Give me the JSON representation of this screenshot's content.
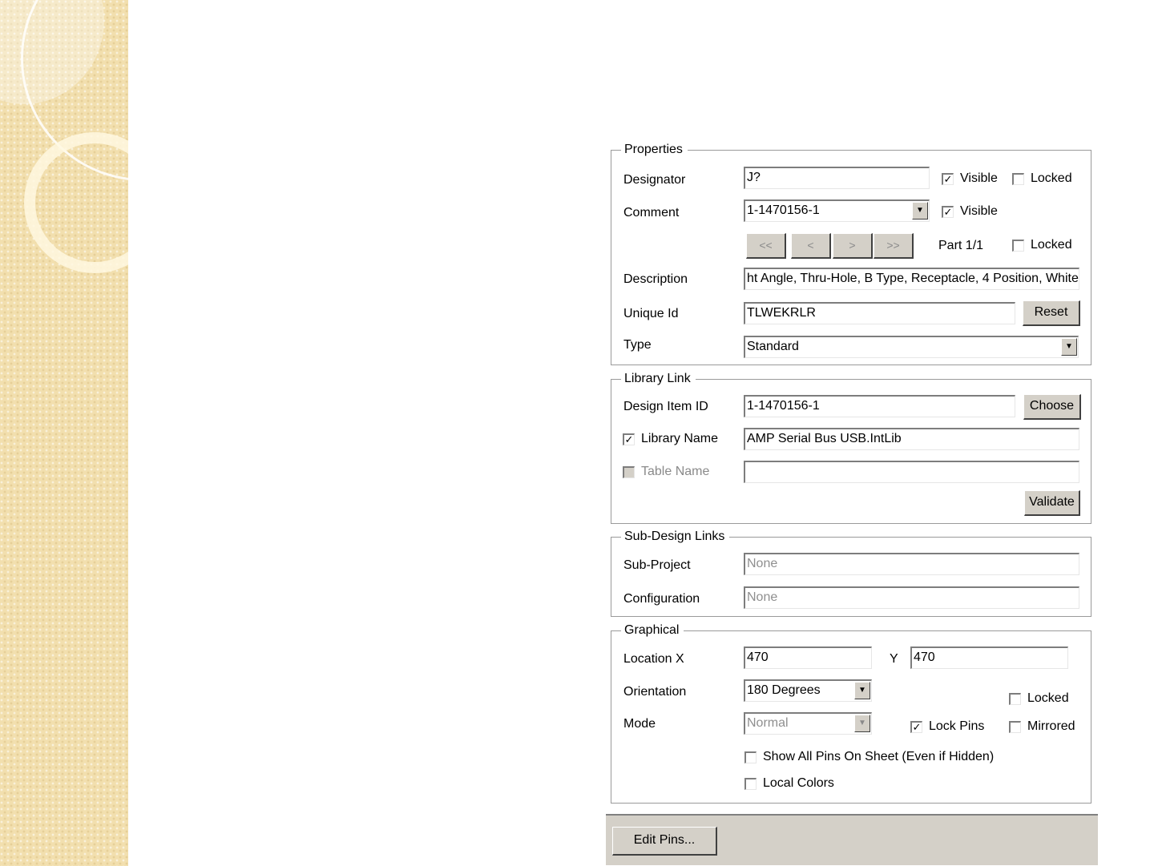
{
  "properties": {
    "title": "Properties",
    "designator": {
      "label": "Designator",
      "value": "J?",
      "visible_label": "Visible",
      "visible_checked": true,
      "locked_label": "Locked",
      "locked_checked": false
    },
    "comment": {
      "label": "Comment",
      "value": "1-1470156-1",
      "visible_label": "Visible",
      "visible_checked": true
    },
    "part_nav": {
      "first": "<<",
      "prev": "<",
      "next": ">",
      "last": ">>",
      "part_label": "Part 1/1",
      "locked_label": "Locked",
      "locked_checked": false
    },
    "description": {
      "label": "Description",
      "value": "ht Angle, Thru-Hole, B Type, Receptacle, 4 Position, White"
    },
    "unique_id": {
      "label": "Unique Id",
      "value": "TLWEKRLR",
      "reset_label": "Reset"
    },
    "type": {
      "label": "Type",
      "value": "Standard"
    }
  },
  "library_link": {
    "title": "Library Link",
    "design_item_id": {
      "label": "Design Item ID",
      "value": "1-1470156-1",
      "choose_label": "Choose"
    },
    "library_name": {
      "label": "Library Name",
      "checked": true,
      "value": "AMP Serial Bus USB.IntLib"
    },
    "table_name": {
      "label": "Table Name",
      "checked": false,
      "value": ""
    },
    "validate_label": "Validate"
  },
  "sub_design_links": {
    "title": "Sub-Design Links",
    "sub_project": {
      "label": "Sub-Project",
      "value": "None"
    },
    "configuration": {
      "label": "Configuration",
      "value": "None"
    }
  },
  "graphical": {
    "title": "Graphical",
    "location": {
      "label": "Location X",
      "x": "470",
      "y_label": "Y",
      "y": "470"
    },
    "orientation": {
      "label": "Orientation",
      "value": "180 Degrees"
    },
    "mode": {
      "label": "Mode",
      "value": "Normal"
    },
    "locked": {
      "label": "Locked",
      "checked": false
    },
    "lock_pins": {
      "label": "Lock Pins",
      "checked": true
    },
    "mirrored": {
      "label": "Mirrored",
      "checked": false
    },
    "show_all_pins": {
      "label": "Show All Pins On Sheet (Even if Hidden)",
      "checked": false
    },
    "local_colors": {
      "label": "Local Colors",
      "checked": false
    }
  },
  "footer": {
    "edit_pins_label": "Edit Pins..."
  },
  "colors": {
    "dialog_face": "#d4d0c8",
    "side_strip": "#f2dfae"
  }
}
